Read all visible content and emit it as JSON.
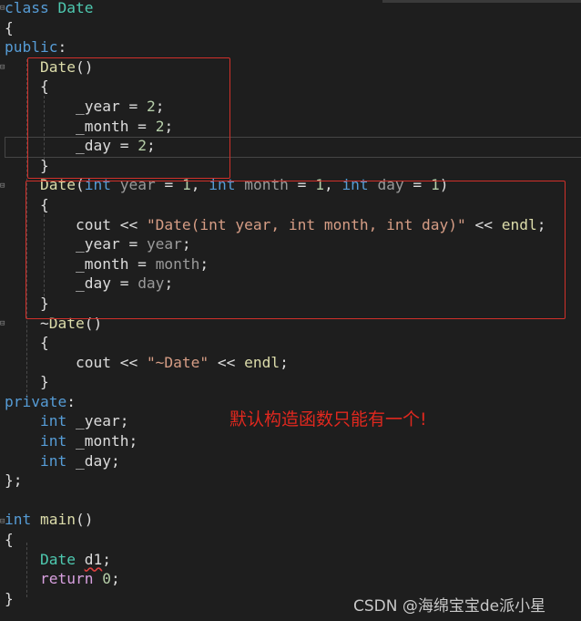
{
  "editor": {
    "colors": {
      "background": "#1e1e1e",
      "keyword": "#569cd6",
      "type": "#4ec9b0",
      "function": "#dcdcaa",
      "number": "#b5cea8",
      "string": "#d69d85",
      "parameter": "#9a9a9a",
      "control": "#d8a0df",
      "annotation_box": "#d0302a"
    },
    "lines": [
      [
        [
          "class",
          "kw"
        ],
        [
          " ",
          "pl"
        ],
        [
          "Date",
          "ty"
        ]
      ],
      [
        [
          "{",
          "pl"
        ]
      ],
      [
        [
          "public",
          "kw"
        ],
        [
          ":",
          "pl"
        ]
      ],
      [
        [
          "    ",
          "pl"
        ],
        [
          "Date",
          "fn"
        ],
        [
          "()",
          "pl"
        ]
      ],
      [
        [
          "    {",
          "pl"
        ]
      ],
      [
        [
          "        _year = ",
          "pl"
        ],
        [
          "2",
          "num"
        ],
        [
          ";",
          "pl"
        ]
      ],
      [
        [
          "        _month = ",
          "pl"
        ],
        [
          "2",
          "num"
        ],
        [
          ";",
          "pl"
        ]
      ],
      [
        [
          "        _day = ",
          "pl"
        ],
        [
          "2",
          "num"
        ],
        [
          ";",
          "pl"
        ]
      ],
      [
        [
          "    }",
          "pl"
        ]
      ],
      [
        [
          "    ",
          "pl"
        ],
        [
          "Date",
          "fn"
        ],
        [
          "(",
          "pl"
        ],
        [
          "int",
          "kw"
        ],
        [
          " ",
          "pl"
        ],
        [
          "year",
          "par"
        ],
        [
          " = ",
          "pl"
        ],
        [
          "1",
          "num"
        ],
        [
          ", ",
          "pl"
        ],
        [
          "int",
          "kw"
        ],
        [
          " ",
          "pl"
        ],
        [
          "month",
          "par"
        ],
        [
          " = ",
          "pl"
        ],
        [
          "1",
          "num"
        ],
        [
          ", ",
          "pl"
        ],
        [
          "int",
          "kw"
        ],
        [
          " ",
          "pl"
        ],
        [
          "day",
          "par"
        ],
        [
          " = ",
          "pl"
        ],
        [
          "1",
          "num"
        ],
        [
          ")",
          "pl"
        ]
      ],
      [
        [
          "    {",
          "pl"
        ]
      ],
      [
        [
          "        cout << ",
          "pl"
        ],
        [
          "\"Date(int year, int month, int day)\"",
          "str"
        ],
        [
          " << ",
          "pl"
        ],
        [
          "endl",
          "fn"
        ],
        [
          ";",
          "pl"
        ]
      ],
      [
        [
          "        _year = ",
          "pl"
        ],
        [
          "year",
          "par"
        ],
        [
          ";",
          "pl"
        ]
      ],
      [
        [
          "        _month = ",
          "pl"
        ],
        [
          "month",
          "par"
        ],
        [
          ";",
          "pl"
        ]
      ],
      [
        [
          "        _day = ",
          "pl"
        ],
        [
          "day",
          "par"
        ],
        [
          ";",
          "pl"
        ]
      ],
      [
        [
          "    }",
          "pl"
        ]
      ],
      [
        [
          "    ~",
          "pl"
        ],
        [
          "Date",
          "fn"
        ],
        [
          "()",
          "pl"
        ]
      ],
      [
        [
          "    {",
          "pl"
        ]
      ],
      [
        [
          "        cout << ",
          "pl"
        ],
        [
          "\"~Date\"",
          "str"
        ],
        [
          " << ",
          "pl"
        ],
        [
          "endl",
          "fn"
        ],
        [
          ";",
          "pl"
        ]
      ],
      [
        [
          "    }",
          "pl"
        ]
      ],
      [
        [
          "private",
          "kw"
        ],
        [
          ":",
          "pl"
        ]
      ],
      [
        [
          "    ",
          "pl"
        ],
        [
          "int",
          "kw"
        ],
        [
          " _year;",
          "pl"
        ]
      ],
      [
        [
          "    ",
          "pl"
        ],
        [
          "int",
          "kw"
        ],
        [
          " _month;",
          "pl"
        ]
      ],
      [
        [
          "    ",
          "pl"
        ],
        [
          "int",
          "kw"
        ],
        [
          " _day;",
          "pl"
        ]
      ],
      [
        [
          "};",
          "pl"
        ]
      ],
      [
        [
          "",
          "pl"
        ]
      ],
      [
        [
          "int",
          "kw"
        ],
        [
          " ",
          "pl"
        ],
        [
          "main",
          "fn"
        ],
        [
          "()",
          "pl"
        ]
      ],
      [
        [
          "{",
          "pl"
        ]
      ],
      [
        [
          "    ",
          "pl"
        ],
        [
          "Date",
          "ty"
        ],
        [
          " ",
          "pl"
        ],
        [
          "d1",
          "pl sq"
        ],
        [
          ";",
          "pl"
        ]
      ],
      [
        [
          "    ",
          "pl"
        ],
        [
          "return",
          "ret"
        ],
        [
          " ",
          "pl"
        ],
        [
          "0",
          "num"
        ],
        [
          ";",
          "pl"
        ]
      ],
      [
        [
          "}",
          "pl"
        ]
      ]
    ]
  },
  "annotation": {
    "note": "默认构造函数只能有一个!"
  },
  "watermark": "CSDN @海绵宝宝de派小星"
}
